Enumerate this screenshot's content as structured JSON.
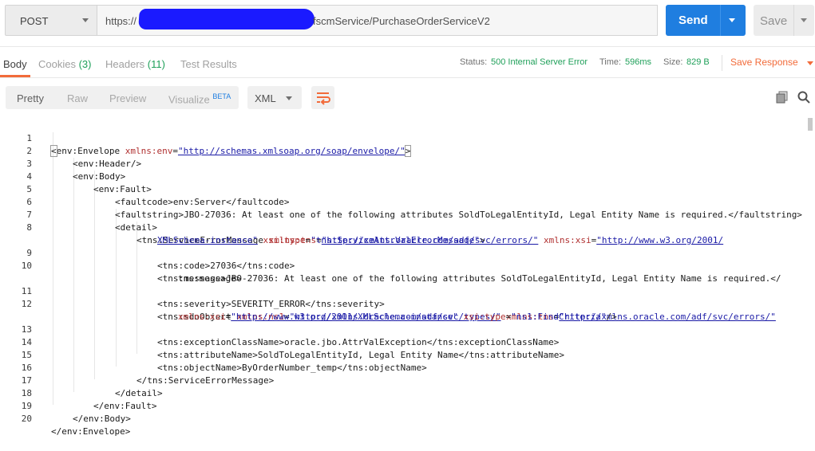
{
  "request": {
    "method": "POST",
    "url_prefix": "https://",
    "url_suffix": "fscmService/PurchaseOrderServiceV2",
    "send_label": "Send",
    "save_label": "Save"
  },
  "response_tabs": {
    "body": "Body",
    "cookies": "Cookies",
    "cookies_count": "(3)",
    "headers": "Headers",
    "headers_count": "(11)",
    "test_results": "Test Results"
  },
  "status": {
    "status_label": "Status:",
    "status_value": "500 Internal Server Error",
    "time_label": "Time:",
    "time_value": "596ms",
    "size_label": "Size:",
    "size_value": "829 B",
    "save_response": "Save Response"
  },
  "view": {
    "pretty": "Pretty",
    "raw": "Raw",
    "preview": "Preview",
    "visualize": "Visualize",
    "beta": "BETA",
    "format": "XML"
  },
  "icons": {
    "copy": "copy-icon",
    "search": "search-icon",
    "wrap": "wrap-lines-icon"
  },
  "colors": {
    "accent": "#f26b3a",
    "send": "#1f7ee0",
    "success": "#20a05a"
  },
  "code_lines": [
    "1",
    "2",
    "3",
    "4",
    "5",
    "6",
    "7",
    "8",
    "9",
    "10",
    "11",
    "12",
    "13",
    "14",
    "15",
    "16",
    "17",
    "18",
    "19",
    "20"
  ]
}
